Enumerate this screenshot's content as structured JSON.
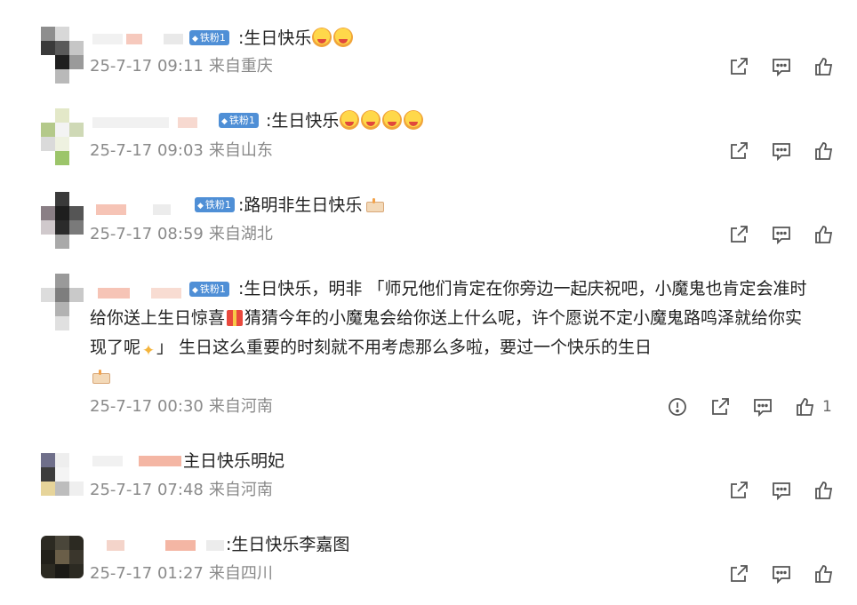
{
  "comments": [
    {
      "text": ":生日快乐",
      "badge": "铁粉1",
      "time": "25-7-17 09:11",
      "location": "来自重庆",
      "emoji_count": 2
    },
    {
      "text": ":生日快乐",
      "badge": "铁粉1",
      "time": "25-7-17 09:03",
      "location": "来自山东",
      "emoji_count": 4
    },
    {
      "text": ":路明非生日快乐",
      "badge": "铁粉1",
      "time": "25-7-17 08:59",
      "location": "来自湖北"
    },
    {
      "badge": "铁粉1",
      "line1": ":生日快乐，明非 「师兄他们肯定在你旁边一起庆祝吧，小魔鬼也肯定会准时",
      "line2a": "给你送上生日惊喜",
      "line2b": "猜猜今年的小魔鬼会给你送上什么呢，许个愿说不定小魔鬼路鸣泽就给你实",
      "line3a": "现了呢",
      "line3b": "」 生日这么重要的时刻就不用考虑那么多啦，要过一个快乐的生日",
      "time": "25-7-17 00:30",
      "location": "来自河南",
      "like_count": "1"
    },
    {
      "text": "主日快乐明妃",
      "time": "25-7-17 07:48",
      "location": "来自河南"
    },
    {
      "text": ":生日快乐李嘉图",
      "time": "25-7-17 01:27",
      "location": "来自四川"
    }
  ],
  "icons": {
    "share": "share-icon",
    "reply": "comment-icon",
    "like": "thumbs-up-icon",
    "report": "report-icon"
  },
  "colors": {
    "badge": "#4f8fd6",
    "meta": "#8a8a8a",
    "icon": "#555555"
  }
}
